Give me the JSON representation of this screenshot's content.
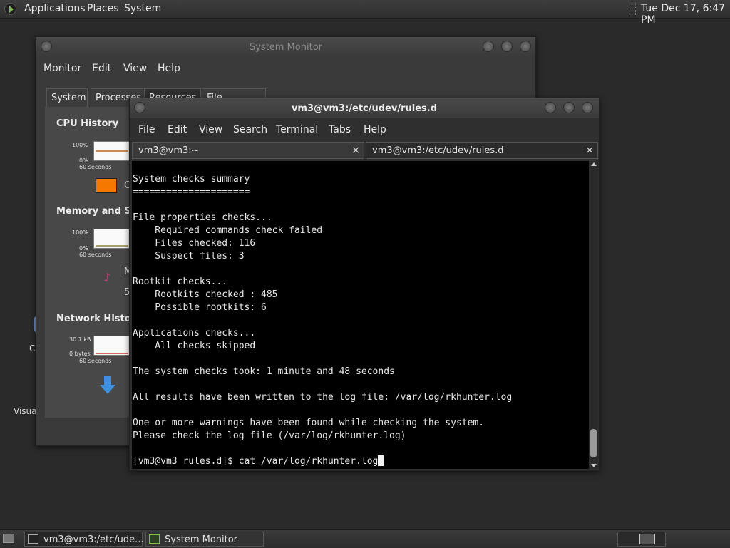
{
  "top_panel": {
    "menus": [
      "Applications",
      "Places",
      "System"
    ],
    "clock": "Tue Dec 17,  6:47 PM"
  },
  "desktop": {
    "icon_label_1": "C",
    "icon_label_2": "Visua"
  },
  "system_monitor": {
    "title": "System Monitor",
    "menu": [
      "Monitor",
      "Edit",
      "View",
      "Help"
    ],
    "tabs": [
      "System",
      "Processes",
      "Resources",
      "File Systems"
    ],
    "cpu": {
      "title": "CPU History",
      "y_top": "100%",
      "y_bottom": "0%",
      "x_label": "60 seconds",
      "legend_initial": "C",
      "color": "#f57900"
    },
    "memory": {
      "title": "Memory and Swap History",
      "y_top": "100%",
      "y_bottom": "0%",
      "x_label": "60 seconds",
      "legend_initial": "M",
      "legend_value": "5"
    },
    "network": {
      "title": "Network History",
      "y_top": "30.7 kB",
      "y_bottom": "0 bytes",
      "x_label": "60 seconds"
    }
  },
  "terminal": {
    "title": "vm3@vm3:/etc/udev/rules.d",
    "menu": [
      "File",
      "Edit",
      "View",
      "Search",
      "Terminal",
      "Tabs",
      "Help"
    ],
    "tabs": [
      {
        "label": "vm3@vm3:~"
      },
      {
        "label": "vm3@vm3:/etc/udev/rules.d"
      }
    ],
    "close_glyph": "×",
    "lines": [
      "System checks summary",
      "=====================",
      "",
      "File properties checks...",
      "    Required commands check failed",
      "    Files checked: 116",
      "    Suspect files: 3",
      "",
      "Rootkit checks...",
      "    Rootkits checked : 485",
      "    Possible rootkits: 6",
      "",
      "Applications checks...",
      "    All checks skipped",
      "",
      "The system checks took: 1 minute and 48 seconds",
      "",
      "All results have been written to the log file: /var/log/rkhunter.log",
      "",
      "One or more warnings have been found while checking the system.",
      "Please check the log file (/var/log/rkhunter.log)",
      ""
    ],
    "prompt": "[vm3@vm3 rules.d]$ ",
    "command": "cat /var/log/rkhunter.log"
  },
  "taskbar": {
    "items": [
      {
        "label": "vm3@vm3:/etc/ude..."
      },
      {
        "label": "System Monitor"
      }
    ]
  }
}
